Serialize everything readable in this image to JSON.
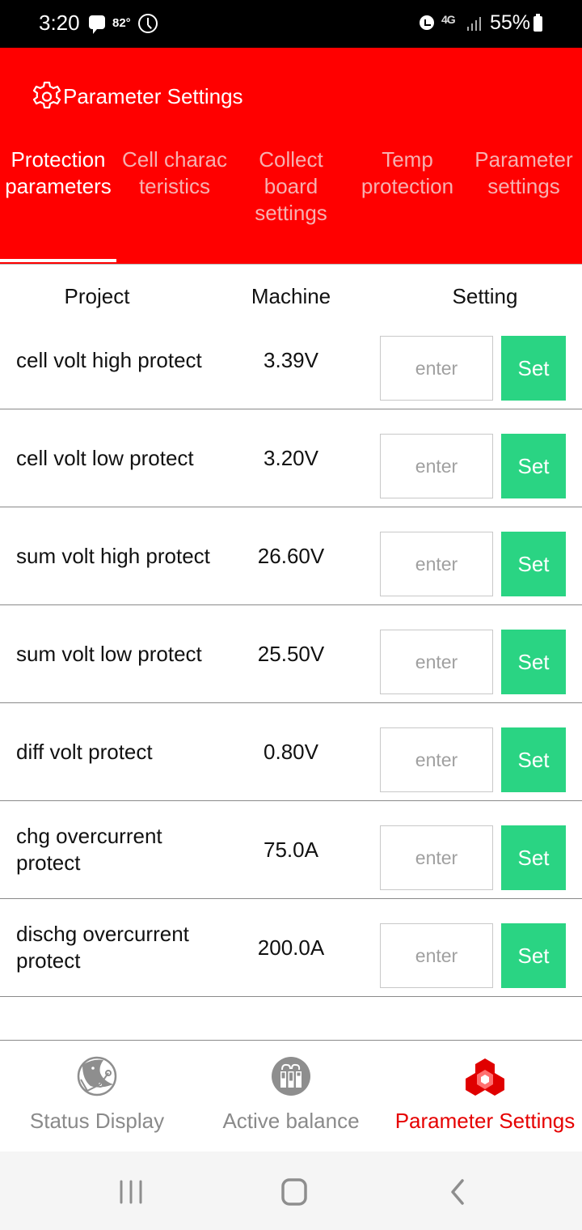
{
  "status_bar": {
    "time": "3:20",
    "temperature": "82°",
    "network": "4G",
    "battery": "55%"
  },
  "header": {
    "title": "Parameter Settings",
    "icon": "gear-icon"
  },
  "tabs": [
    {
      "label": "Protection parameters",
      "active": true
    },
    {
      "label": "Cell charac teristics",
      "active": false
    },
    {
      "label": "Collect board settings",
      "active": false
    },
    {
      "label": "Temp protection",
      "active": false
    },
    {
      "label": "Parameter settings",
      "active": false
    }
  ],
  "table": {
    "columns": [
      "Project",
      "Machine",
      "Setting"
    ],
    "input_placeholder": "enter",
    "set_label": "Set",
    "rows": [
      {
        "project": "cell volt high protect",
        "machine": "3.39V"
      },
      {
        "project": "cell volt low protect",
        "machine": "3.20V"
      },
      {
        "project": "sum volt high protect",
        "machine": "26.60V"
      },
      {
        "project": "sum volt low protect",
        "machine": "25.50V"
      },
      {
        "project": "diff volt protect",
        "machine": "0.80V"
      },
      {
        "project": "chg overcurrent protect",
        "machine": "75.0A"
      },
      {
        "project": "dischg overcurrent protect",
        "machine": "200.0A"
      }
    ]
  },
  "bottom_nav": [
    {
      "label": "Status Display",
      "icon": "globe-icon",
      "active": false
    },
    {
      "label": "Active balance",
      "icon": "battery-balance-icon",
      "active": false
    },
    {
      "label": "Parameter Settings",
      "icon": "cubes-icon",
      "active": true
    }
  ],
  "colors": {
    "brand_red": "#ff0000",
    "set_button_green": "#2ad483",
    "active_nav_red": "#e60000",
    "inactive_gray": "#8a8a8a"
  }
}
